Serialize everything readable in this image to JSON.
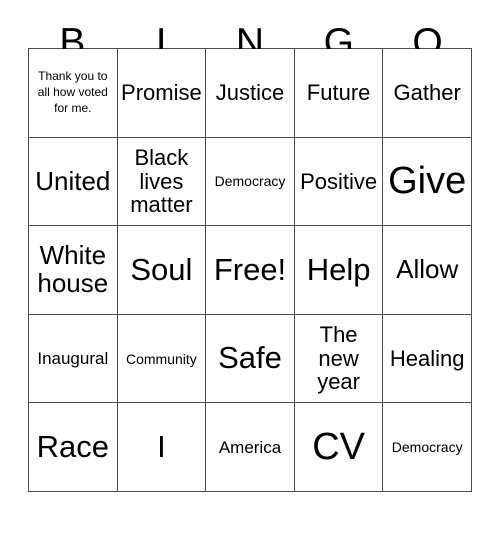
{
  "card": {
    "title_letters": [
      "B",
      "I",
      "N",
      "G",
      "O"
    ],
    "columns": [
      "B",
      "I",
      "N",
      "G",
      "O"
    ],
    "grid_size": "5x5",
    "border_color": "#4d4d4d",
    "background_color": "#ffffff",
    "text_color": "#000000",
    "rows": [
      [
        {
          "text": "Thank you to all how voted for me.",
          "size": "xxs"
        },
        {
          "text": "Promise",
          "size": "m"
        },
        {
          "text": "Justice",
          "size": "m"
        },
        {
          "text": "Future",
          "size": "m"
        },
        {
          "text": "Gather",
          "size": "m"
        }
      ],
      [
        {
          "text": "United",
          "size": "l"
        },
        {
          "text": "Black\nlives\nmatter",
          "size": "m"
        },
        {
          "text": "Democracy",
          "size": "xs"
        },
        {
          "text": "Positive",
          "size": "m"
        },
        {
          "text": "Give",
          "size": "xxl"
        }
      ],
      [
        {
          "text": "White\nhouse",
          "size": "l"
        },
        {
          "text": "Soul",
          "size": "xl"
        },
        {
          "text": "Free!",
          "size": "xl"
        },
        {
          "text": "Help",
          "size": "xl"
        },
        {
          "text": "Allow",
          "size": "l"
        }
      ],
      [
        {
          "text": "Inaugural",
          "size": "s"
        },
        {
          "text": "Community",
          "size": "xs"
        },
        {
          "text": "Safe",
          "size": "xl"
        },
        {
          "text": "The\nnew\nyear",
          "size": "m"
        },
        {
          "text": "Healing",
          "size": "m"
        }
      ],
      [
        {
          "text": "Race",
          "size": "xl"
        },
        {
          "text": "I",
          "size": "xl"
        },
        {
          "text": "America",
          "size": "s"
        },
        {
          "text": "CV",
          "size": "xxl"
        },
        {
          "text": "Democracy",
          "size": "xs"
        }
      ]
    ]
  }
}
